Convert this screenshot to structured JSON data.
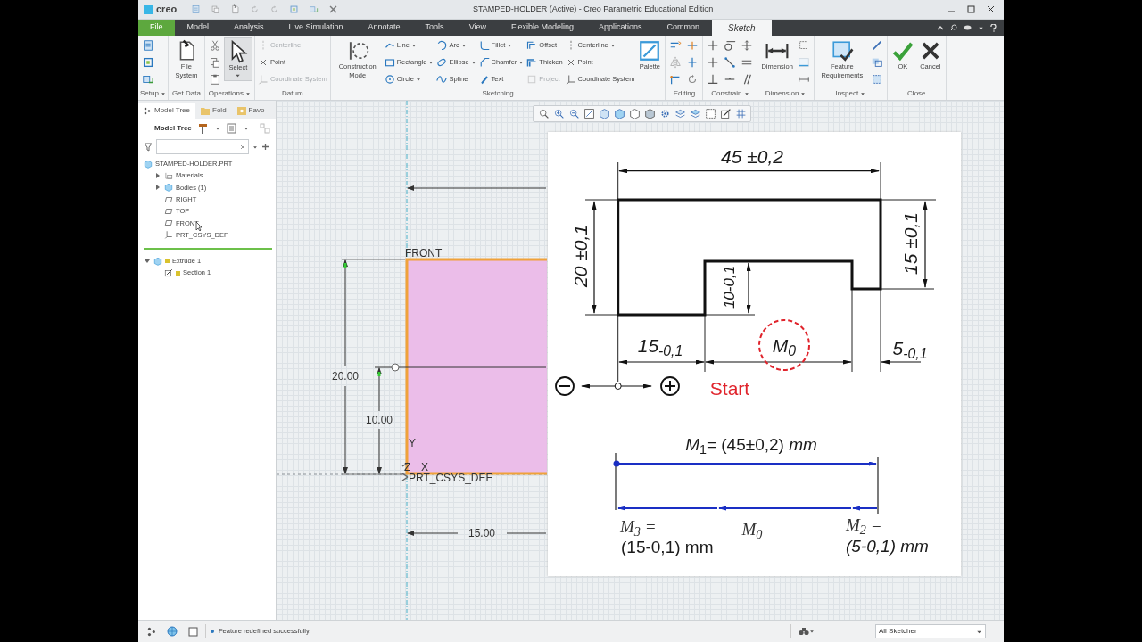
{
  "window": {
    "app_name": "creo",
    "title": "STAMPED-HOLDER (Active) - Creo Parametric Educational Edition"
  },
  "tabs": [
    {
      "label": "File",
      "kind": "file",
      "selected": false
    },
    {
      "label": "Model",
      "kind": "tab",
      "selected": false
    },
    {
      "label": "Analysis",
      "kind": "tab",
      "selected": false
    },
    {
      "label": "Live Simulation",
      "kind": "tab",
      "selected": false
    },
    {
      "label": "Annotate",
      "kind": "tab",
      "selected": false
    },
    {
      "label": "Tools",
      "kind": "tab",
      "selected": false
    },
    {
      "label": "View",
      "kind": "tab",
      "selected": false
    },
    {
      "label": "Flexible Modeling",
      "kind": "tab",
      "selected": false
    },
    {
      "label": "Applications",
      "kind": "tab",
      "selected": false
    },
    {
      "label": "Common",
      "kind": "tab",
      "selected": false
    },
    {
      "label": "Sketch",
      "kind": "tab",
      "selected": true
    }
  ],
  "ribbon": {
    "groups": [
      {
        "label": "Setup",
        "dropdown": true
      },
      {
        "label": "Get Data",
        "dropdown": false,
        "items": [
          {
            "label": "File System",
            "disabled": false,
            "dropdown": false,
            "selected": false
          }
        ]
      },
      {
        "label": "Operations",
        "dropdown": true,
        "items": [
          {
            "label": "Select",
            "disabled": false,
            "dropdown": true,
            "selected": true
          }
        ]
      },
      {
        "label": "Datum",
        "dropdown": false,
        "items": [
          {
            "label": "Centerline",
            "disabled": true,
            "dropdown": false,
            "selected": false
          },
          {
            "label": "Point",
            "disabled": false,
            "dropdown": false,
            "selected": false
          },
          {
            "label": "Coordinate System",
            "disabled": true,
            "dropdown": false,
            "selected": false
          }
        ]
      },
      {
        "label": "Sketching",
        "dropdown": false,
        "items": [
          {
            "label": "Construction Mode",
            "disabled": false,
            "dropdown": false,
            "selected": false
          },
          {
            "label": "Line",
            "disabled": false,
            "dropdown": true,
            "selected": false
          },
          {
            "label": "Rectangle",
            "disabled": false,
            "dropdown": true,
            "selected": false
          },
          {
            "label": "Circle",
            "disabled": false,
            "dropdown": true,
            "selected": false
          },
          {
            "label": "Arc",
            "disabled": false,
            "dropdown": true,
            "selected": false
          },
          {
            "label": "Ellipse",
            "disabled": false,
            "dropdown": true,
            "selected": false
          },
          {
            "label": "Spline",
            "disabled": false,
            "dropdown": false,
            "selected": false
          },
          {
            "label": "Fillet",
            "disabled": false,
            "dropdown": true,
            "selected": false
          },
          {
            "label": "Chamfer",
            "disabled": false,
            "dropdown": true,
            "selected": false
          },
          {
            "label": "Text",
            "disabled": false,
            "dropdown": false,
            "selected": false
          },
          {
            "label": "Offset",
            "disabled": false,
            "dropdown": false,
            "selected": false
          },
          {
            "label": "Thicken",
            "disabled": false,
            "dropdown": false,
            "selected": false
          },
          {
            "label": "Project",
            "disabled": true,
            "dropdown": false,
            "selected": false
          },
          {
            "label": "Centerline",
            "disabled": false,
            "dropdown": true,
            "selected": false
          },
          {
            "label": "Point",
            "disabled": false,
            "dropdown": false,
            "selected": false
          },
          {
            "label": "Coordinate System",
            "disabled": false,
            "dropdown": false,
            "selected": false
          },
          {
            "label": "Palette",
            "disabled": false,
            "dropdown": false,
            "selected": false
          }
        ]
      },
      {
        "label": "Editing",
        "dropdown": false
      },
      {
        "label": "Constrain",
        "dropdown": true
      },
      {
        "label": "Dimension",
        "dropdown": true,
        "items": [
          {
            "label": "Dimension",
            "disabled": false,
            "dropdown": false,
            "selected": false
          }
        ]
      },
      {
        "label": "Inspect",
        "dropdown": true,
        "items": [
          {
            "label": "Feature Requirements",
            "disabled": false,
            "dropdown": false,
            "selected": false
          }
        ]
      },
      {
        "label": "Close",
        "dropdown": false,
        "items": [
          {
            "label": "OK",
            "disabled": false,
            "dropdown": false,
            "selected": false
          },
          {
            "label": "Cancel",
            "disabled": false,
            "dropdown": false,
            "selected": false
          }
        ]
      }
    ]
  },
  "sidebar": {
    "tabs": [
      {
        "label": "Model Tree",
        "selected": true
      },
      {
        "label": "Fold",
        "selected": false
      },
      {
        "label": "Favo",
        "selected": false
      }
    ],
    "heading": "Model Tree",
    "tree": [
      {
        "label": "STAMPED-HOLDER.PRT",
        "kind": "part",
        "children": [
          {
            "label": "Materials",
            "kind": "materials",
            "expanded": false
          },
          {
            "label": "Bodies (1)",
            "kind": "bodies",
            "expanded": false
          },
          {
            "label": "RIGHT",
            "kind": "plane"
          },
          {
            "label": "TOP",
            "kind": "plane"
          },
          {
            "label": "FRONT",
            "kind": "plane"
          },
          {
            "label": "PRT_CSYS_DEF",
            "kind": "csys"
          }
        ]
      }
    ],
    "features": [
      {
        "label": "Extrude 1",
        "kind": "extrude",
        "expanded": true,
        "children": [
          {
            "label": "Section 1",
            "kind": "section"
          }
        ]
      }
    ]
  },
  "sketch": {
    "labels": [
      "FRONT",
      "20.00",
      "10.00",
      "Y",
      "Z",
      "X",
      "PRT_CSYS_DEF",
      "15.00"
    ]
  },
  "reference_image": {
    "labels": [
      {
        "text": "45 ±0,2",
        "kind": "dimension"
      },
      {
        "text": "20 ±0,1",
        "kind": "dimension"
      },
      {
        "text": "15 ±0,1",
        "kind": "dimension"
      },
      {
        "text": "10-0,1",
        "kind": "dimension"
      },
      {
        "text": "15$_{-0,1}$",
        "kind": "dimension"
      },
      {
        "text": "M$_{0}$",
        "kind": "dimension"
      },
      {
        "text": "5$_{-0,1}$",
        "kind": "dimension"
      },
      {
        "text": "Start",
        "kind": "start"
      },
      {
        "text": "*M*$_{1}$= (45±0,2) *mm*",
        "kind": "formula"
      },
      {
        "text": "M$_{3}$ =",
        "kind": "symbol"
      },
      {
        "text": "(15-0,1) mm",
        "kind": "formula"
      },
      {
        "text": "M$_{0}$",
        "kind": "symbol"
      },
      {
        "text": "M$_{2}$ =",
        "kind": "symbol"
      },
      {
        "text": "(5-0,1) mm",
        "kind": "formula_italic"
      }
    ]
  },
  "status_bar": {
    "message": "Feature redefined successfully.",
    "filter": "All Sketcher"
  }
}
